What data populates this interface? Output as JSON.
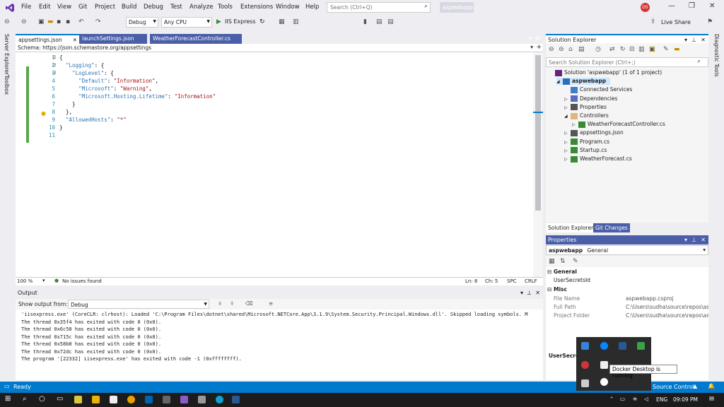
{
  "titlebar": {
    "menu": [
      "File",
      "Edit",
      "View",
      "Git",
      "Project",
      "Build",
      "Debug",
      "Test",
      "Analyze",
      "Tools",
      "Extensions",
      "Window",
      "Help"
    ],
    "search_placeholder": "Search (Ctrl+Q)",
    "project_name": "aspwebapp",
    "avatar_initials": "DS",
    "window_controls": [
      "—",
      "❐",
      "✕"
    ]
  },
  "toolbar": {
    "config": "Debug",
    "platform": "Any CPU",
    "run_label": "IIS Express",
    "live_share": "Live Share"
  },
  "left_strip": {
    "items": [
      "Server Explorer",
      "Toolbox"
    ]
  },
  "right_strip": {
    "items": [
      "Diagnostic Tools"
    ]
  },
  "editor": {
    "tabs": [
      {
        "label": "appsettings.json",
        "active": true
      },
      {
        "label": "launchSettings.json",
        "active": false
      },
      {
        "label": "WeatherForecastController.cs",
        "active": false
      }
    ],
    "schema_label": "Schema:",
    "schema_url": "https://json.schemastore.org/appsettings",
    "line_numbers": [
      "1",
      "2",
      "3",
      "4",
      "5",
      "6",
      "7",
      "8",
      "9",
      "10",
      "11"
    ],
    "lines": [
      {
        "p": "{"
      },
      {
        "p": "  ",
        "k": "\"Logging\"",
        "r": ": {"
      },
      {
        "p": "    ",
        "k": "\"LogLevel\"",
        "r": ": {"
      },
      {
        "p": "      ",
        "k": "\"Default\"",
        "r": ": ",
        "s": "\"Information\"",
        "e": ","
      },
      {
        "p": "      ",
        "k": "\"Microsoft\"",
        "r": ": ",
        "s": "\"Warning\"",
        "e": ","
      },
      {
        "p": "      ",
        "k": "\"Microsoft.Hosting.Lifetime\"",
        "r": ": ",
        "s": "\"Information\""
      },
      {
        "p": "    }"
      },
      {
        "p": "  },"
      },
      {
        "p": "  ",
        "k": "\"AllowedHosts\"",
        "r": ": ",
        "s": "\"*\""
      },
      {
        "p": "}"
      },
      {
        "p": ""
      }
    ],
    "zoom": "100 %",
    "issues": "No issues found",
    "ln": "Ln: 8",
    "ch": "Ch: 5",
    "spc": "SPC",
    "crlf": "CRLF"
  },
  "output": {
    "title": "Output",
    "show_from_label": "Show output from:",
    "source": "Debug",
    "lines": [
      "'iisexpress.exe' (CoreCLR: clrhost): Loaded 'C:\\Program Files\\dotnet\\shared\\Microsoft.NETCore.App\\3.1.9\\System.Security.Principal.Windows.dll'. Skipped loading symbols. M",
      "The thread 0x35f4 has exited with code 0 (0x0).",
      "The thread 0x6c58 has exited with code 0 (0x0).",
      "The thread 0x715c has exited with code 0 (0x0).",
      "The thread 0x58b8 has exited with code 0 (0x0).",
      "The thread 0x72dc has exited with code 0 (0x0).",
      "The program '[22332] iisexpress.exe' has exited with code -1 (0xffffffff)."
    ]
  },
  "solution_explorer": {
    "title": "Solution Explorer",
    "search_placeholder": "Search Solution Explorer (Ctrl+;)",
    "nodes": [
      {
        "label": "Solution 'aspwebapp' (1 of 1 project)",
        "indent": 0,
        "icon": "solution-icon",
        "bold": false,
        "arrow": ""
      },
      {
        "label": "aspwebapp",
        "indent": 1,
        "icon": "project-icon",
        "bold": true,
        "arrow": "◢"
      },
      {
        "label": "Connected Services",
        "indent": 2,
        "icon": "connected-services-icon",
        "bold": false,
        "arrow": ""
      },
      {
        "label": "Dependencies",
        "indent": 2,
        "icon": "dependencies-icon",
        "bold": false,
        "arrow": "▷"
      },
      {
        "label": "Properties",
        "indent": 2,
        "icon": "properties-icon",
        "bold": false,
        "arrow": "▷"
      },
      {
        "label": "Controllers",
        "indent": 2,
        "icon": "folder-icon",
        "bold": false,
        "arrow": "◢"
      },
      {
        "label": "WeatherForecastController.cs",
        "indent": 3,
        "icon": "csharp-file-icon",
        "bold": false,
        "arrow": "▷"
      },
      {
        "label": "appsettings.json",
        "indent": 2,
        "icon": "json-file-icon",
        "bold": false,
        "arrow": "▷"
      },
      {
        "label": "Program.cs",
        "indent": 2,
        "icon": "csharp-file-icon",
        "bold": false,
        "arrow": "▷"
      },
      {
        "label": "Startup.cs",
        "indent": 2,
        "icon": "csharp-file-icon",
        "bold": false,
        "arrow": "▷"
      },
      {
        "label": "WeatherForecast.cs",
        "indent": 2,
        "icon": "csharp-file-icon",
        "bold": false,
        "arrow": "▷"
      }
    ],
    "tabs": [
      "Solution Explorer",
      "Git Changes"
    ]
  },
  "properties": {
    "title": "Properties",
    "object": "aspwebapp",
    "object_type": "General",
    "rows": [
      {
        "type": "cat",
        "name": "General"
      },
      {
        "type": "prop",
        "name": "UserSecretsId",
        "value": ""
      },
      {
        "type": "cat",
        "name": "Misc"
      },
      {
        "type": "prop",
        "name": "File Name",
        "value": "aspwebapp.csproj"
      },
      {
        "type": "prop",
        "name": "Full Path",
        "value": "C:\\Users\\sudha\\source\\repos\\asp"
      },
      {
        "type": "prop",
        "name": "Project Folder",
        "value": "C:\\Users\\sudha\\source\\repos\\asp"
      }
    ],
    "desc_name": "UserSecre"
  },
  "status": {
    "ready": "Ready",
    "source_control": "Source Control"
  },
  "taskbar": {
    "lang": "ENG",
    "time": "09:09 PM"
  },
  "tray": {
    "tooltip": "Docker Desktop is running"
  }
}
